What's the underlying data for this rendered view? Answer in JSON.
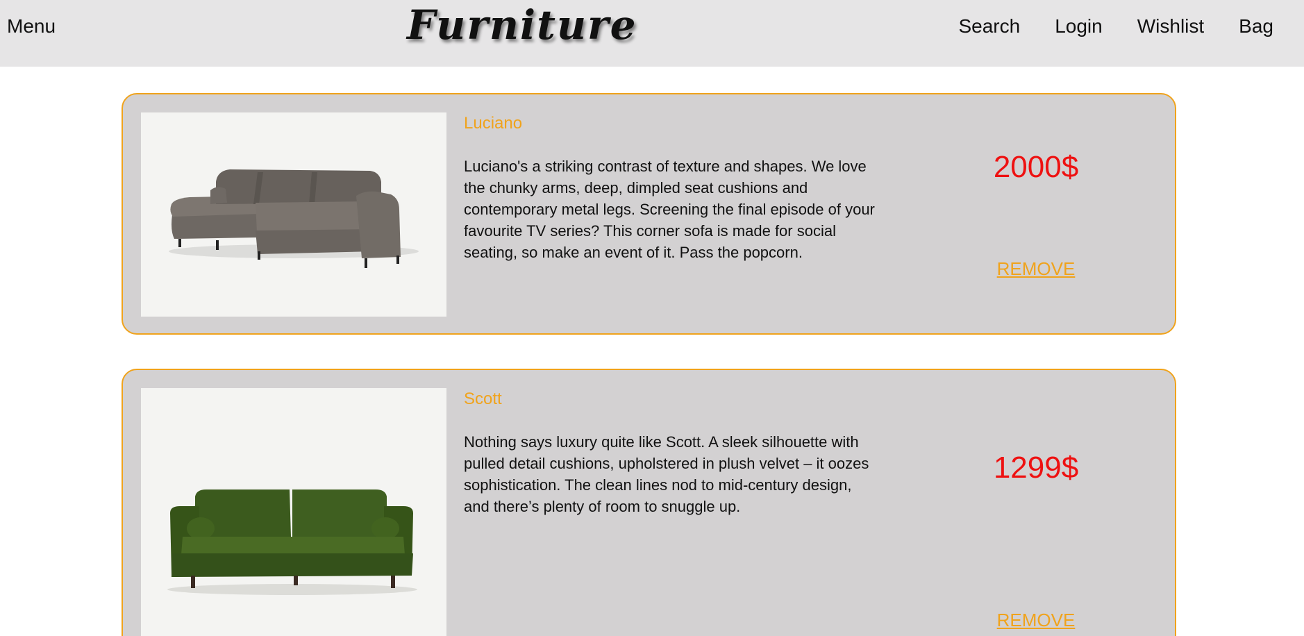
{
  "header": {
    "menu_label": "Menu",
    "brand": "Furniture",
    "nav": {
      "search": "Search",
      "login": "Login",
      "wishlist": "Wishlist",
      "bag": "Bag"
    }
  },
  "colors": {
    "header_bg": "#e6e5e6",
    "card_bg": "#d3d1d2",
    "accent": "#f0a31c",
    "price": "#ee1111"
  },
  "products": [
    {
      "name": "Luciano",
      "description": "Luciano's a striking contrast of texture and shapes. We love the chunky arms, deep, dimpled seat cushions and contemporary metal legs. Screening the final episode of your favourite TV series? This corner sofa is made for social seating, so make an event of it. Pass the popcorn.",
      "price": "2000$",
      "remove_label": "REMOVE",
      "image": "grey-corner-sofa"
    },
    {
      "name": "Scott",
      "description": "Nothing says luxury quite like Scott. A sleek silhouette with pulled detail cushions, upholstered in plush velvet – it oozes sophistication. The clean lines nod to mid-century design, and there’s plenty of room to snuggle up.",
      "price": "1299$",
      "remove_label": "REMOVE",
      "image": "green-velvet-sofa"
    }
  ]
}
